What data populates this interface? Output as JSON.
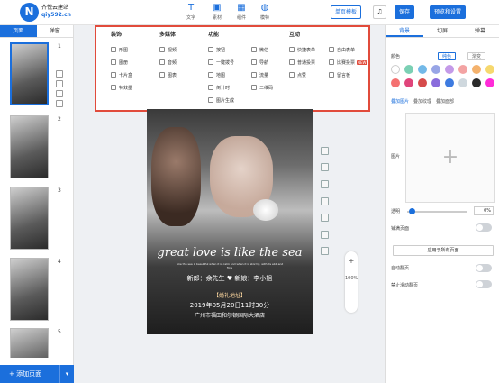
{
  "brand": {
    "logo_letter": "N",
    "name": "齐悦云建站",
    "domain": "qiy592.cn"
  },
  "toolbar": {
    "tools": [
      {
        "label": "文字",
        "icon": "text-icon"
      },
      {
        "label": "素材",
        "icon": "image-icon"
      },
      {
        "label": "组件",
        "icon": "component-icon"
      },
      {
        "label": "模特",
        "icon": "model-icon"
      }
    ],
    "single_page_mode": "单页模板",
    "music_icon": "♫",
    "save": "保存",
    "preview": "预览和设置"
  },
  "left": {
    "tabs": [
      "页面",
      "弹窗"
    ],
    "pages": [
      "1",
      "2",
      "3",
      "4",
      "5"
    ],
    "add_page": "+ 添加页面",
    "caret": "▾"
  },
  "component_menu": {
    "columns": [
      {
        "head": "装饰",
        "items": [
          "形图",
          "图册",
          "卡片盒",
          "特效墨"
        ]
      },
      {
        "head": "多媒体",
        "items": [
          "视频",
          "音频",
          "图表"
        ]
      },
      {
        "head": "功能",
        "items": [
          "按钮",
          "一键拨号",
          "地图",
          "倒计时",
          "图片生成"
        ]
      },
      {
        "head": "",
        "items": [
          "微信",
          "导航",
          "流量",
          "二维码"
        ]
      },
      {
        "head": "互动",
        "items": [
          "快捷表单",
          "普通投票",
          "点赞"
        ]
      },
      {
        "head": "",
        "items": [
          "自由表单",
          "比赛投票",
          "留言板"
        ]
      }
    ],
    "hot_tag": "NEW"
  },
  "canvas": {
    "headline": "great love is like the sea",
    "subline": "Like the sea is beautiful when it is calm and when it is stormy, with its ebb and flow",
    "names": "新郎：余先生  ♥  新娘：李小姐",
    "addr_title": "【婚礼地址】",
    "date": "2019年05月20日11时30分",
    "venue": "广州市福田和尔顿国际大酒店"
  },
  "zoom": {
    "plus": "+",
    "level": "100%",
    "minus": "−"
  },
  "right": {
    "tabs": [
      "背景",
      "切屏",
      "弹幕"
    ],
    "color_label": "颜色",
    "pills": [
      "纯色",
      "渐变"
    ],
    "swatches": [
      "#ffffff",
      "#7bd0b4",
      "#73b9e8",
      "#98a5e6",
      "#c49ae8",
      "#f3a3a3",
      "#f4b26d",
      "#f6d86e",
      "#f47171",
      "#e0457b",
      "#d64b4b",
      "#8a6cdc",
      "#3e7be0",
      "#cfd8de",
      "#2b2b2b",
      "#ff2bd8"
    ],
    "subtabs": [
      "叠加图片",
      "叠加纹理",
      "叠加面部"
    ],
    "image_label": "图片",
    "opacity_label": "透明",
    "opacity_value": "0%",
    "tile_label": "铺满页面",
    "apply_all": "应用于所有页面",
    "autoflip_label": "自动翻页",
    "noscroll_label": "禁止滑动翻页"
  }
}
